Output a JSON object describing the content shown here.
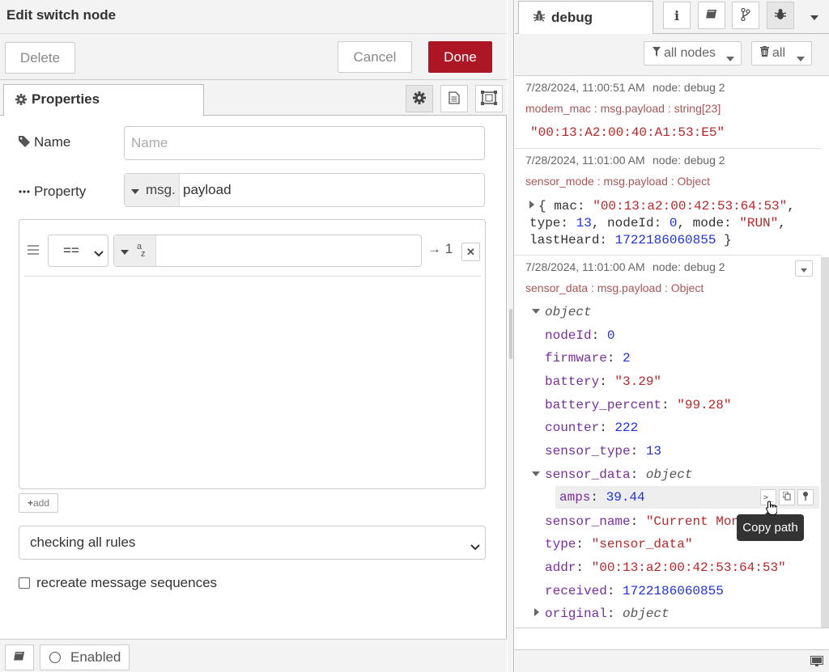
{
  "editor": {
    "title": "Edit switch node",
    "delete_label": "Delete",
    "cancel_label": "Cancel",
    "done_label": "Done",
    "properties_tab": "Properties",
    "name_label": "Name",
    "name_placeholder": "Name",
    "property_label": "Property",
    "property_type": "msg.",
    "property_value": "payload",
    "rule": {
      "operator": "==",
      "value_type_glyph_top": "a",
      "value_type_glyph_bottom": "z",
      "output": "→ 1",
      "remove": "✕"
    },
    "add_label": "add",
    "check_mode": "checking all rules",
    "recreate_label": "recreate message sequences",
    "enabled_label": "Enabled"
  },
  "sidebar": {
    "debug_tab": "debug",
    "filter_nodes": "all nodes",
    "filter_clear": "all",
    "messages": [
      {
        "date": "7/28/2024, 11:00:51 AM",
        "node": "node: debug 2",
        "topic": "modem_mac : msg.payload : string[23]",
        "value": "\"00:13:A2:00:40:A1:53:E5\""
      },
      {
        "date": "7/28/2024, 11:01:00 AM",
        "node": "node: debug 2",
        "topic": "sensor_mode : msg.payload : Object",
        "line1_open": "{ mac: ",
        "line1_mac": "\"00:13:a2:00:42:53:64:53\"",
        "line1_end": ",",
        "line2_k1": "type: ",
        "line2_v1": "13",
        "line2_k2": ", nodeId: ",
        "line2_v2": "0",
        "line2_k3": ", mode: ",
        "line2_v3": "\"RUN\"",
        "line2_end": ",",
        "line3_k": "lastHeard: ",
        "line3_v": "1722186060855",
        "line3_end": " }"
      },
      {
        "date": "7/28/2024, 11:01:00 AM",
        "node": "node: debug 2",
        "topic": "sensor_data : msg.payload : Object",
        "root": "object",
        "props": [
          {
            "key": "nodeId",
            "value": "0",
            "kind": "num"
          },
          {
            "key": "firmware",
            "value": "2",
            "kind": "num"
          },
          {
            "key": "battery",
            "value": "\"3.29\"",
            "kind": "str"
          },
          {
            "key": "battery_percent",
            "value": "\"99.28\"",
            "kind": "str"
          },
          {
            "key": "counter",
            "value": "222",
            "kind": "num"
          },
          {
            "key": "sensor_type",
            "value": "13",
            "kind": "num"
          }
        ],
        "sensor_data_key": "sensor_data",
        "sensor_data_type": "object",
        "amps_key": "amps",
        "amps_value": "39.44",
        "sensor_name_key": "sensor_name",
        "sensor_name_value": "\"Current Mon",
        "type_key": "type",
        "type_value": "\"sensor_data\"",
        "addr_key": "addr",
        "addr_value": "\"00:13:a2:00:42:53:64:53\"",
        "received_key": "received",
        "received_value": "1722186060855",
        "original_key": "original",
        "original_type": "object"
      }
    ],
    "tooltip": "Copy path"
  },
  "colors": {
    "done": "#ad1625",
    "string": "#b72828",
    "number": "#2033d6"
  }
}
